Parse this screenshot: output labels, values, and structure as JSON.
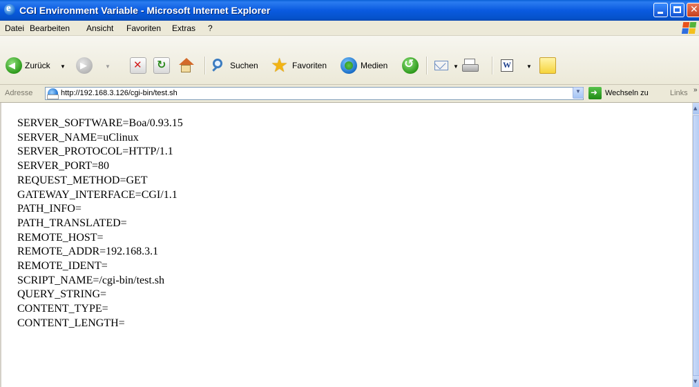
{
  "window": {
    "title": "CGI Environment Variable - Microsoft Internet Explorer"
  },
  "menu": {
    "items": [
      "Datei",
      "Bearbeiten",
      "Ansicht",
      "Favoriten",
      "Extras",
      "?"
    ]
  },
  "toolbar": {
    "back_label": "Zurück",
    "search_label": "Suchen",
    "favorites_label": "Favoriten",
    "media_label": "Medien",
    "icons": [
      "back-icon",
      "forward-icon",
      "stop-icon",
      "refresh-icon",
      "home-icon",
      "search-icon",
      "favorites-icon",
      "media-icon",
      "history-icon",
      "mail-icon",
      "print-icon",
      "edit-icon",
      "messenger-icon"
    ]
  },
  "address": {
    "label": "Adresse",
    "url": "http://192.168.3.126/cgi-bin/test.sh",
    "go_label": "Wechseln zu",
    "links_label": "Links"
  },
  "content": {
    "env_vars": [
      "SERVER_SOFTWARE=Boa/0.93.15",
      "SERVER_NAME=uClinux",
      "SERVER_PROTOCOL=HTTP/1.1",
      "SERVER_PORT=80",
      "REQUEST_METHOD=GET",
      "GATEWAY_INTERFACE=CGI/1.1",
      "PATH_INFO=",
      "PATH_TRANSLATED=",
      "REMOTE_HOST=",
      "REMOTE_ADDR=192.168.3.1",
      "REMOTE_IDENT=",
      "SCRIPT_NAME=/cgi-bin/test.sh",
      "QUERY_STRING=",
      "CONTENT_TYPE=",
      "CONTENT_LENGTH="
    ]
  },
  "colors": {
    "titlebar": "#0a5ae0",
    "chrome": "#ece9d8",
    "page_bg": "#ffffff"
  }
}
